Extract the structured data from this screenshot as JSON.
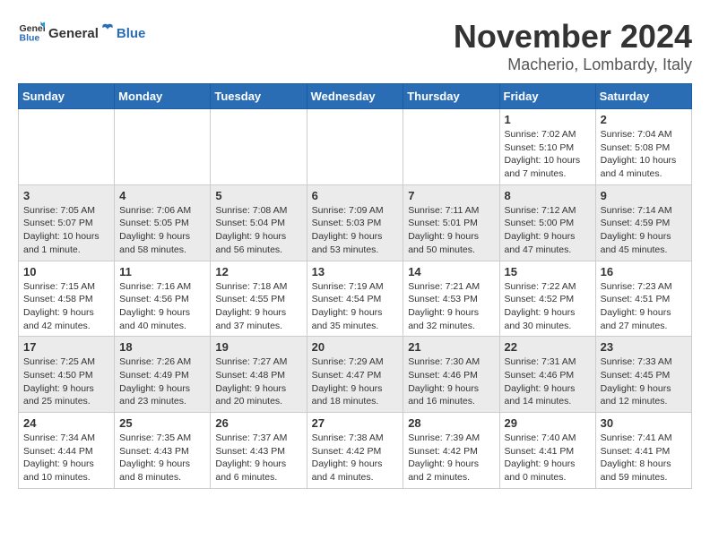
{
  "header": {
    "logo_general": "General",
    "logo_blue": "Blue",
    "month_title": "November 2024",
    "location": "Macherio, Lombardy, Italy"
  },
  "weekdays": [
    "Sunday",
    "Monday",
    "Tuesday",
    "Wednesday",
    "Thursday",
    "Friday",
    "Saturday"
  ],
  "weeks": [
    [
      {
        "day": "",
        "info": ""
      },
      {
        "day": "",
        "info": ""
      },
      {
        "day": "",
        "info": ""
      },
      {
        "day": "",
        "info": ""
      },
      {
        "day": "",
        "info": ""
      },
      {
        "day": "1",
        "info": "Sunrise: 7:02 AM\nSunset: 5:10 PM\nDaylight: 10 hours and 7 minutes."
      },
      {
        "day": "2",
        "info": "Sunrise: 7:04 AM\nSunset: 5:08 PM\nDaylight: 10 hours and 4 minutes."
      }
    ],
    [
      {
        "day": "3",
        "info": "Sunrise: 7:05 AM\nSunset: 5:07 PM\nDaylight: 10 hours and 1 minute."
      },
      {
        "day": "4",
        "info": "Sunrise: 7:06 AM\nSunset: 5:05 PM\nDaylight: 9 hours and 58 minutes."
      },
      {
        "day": "5",
        "info": "Sunrise: 7:08 AM\nSunset: 5:04 PM\nDaylight: 9 hours and 56 minutes."
      },
      {
        "day": "6",
        "info": "Sunrise: 7:09 AM\nSunset: 5:03 PM\nDaylight: 9 hours and 53 minutes."
      },
      {
        "day": "7",
        "info": "Sunrise: 7:11 AM\nSunset: 5:01 PM\nDaylight: 9 hours and 50 minutes."
      },
      {
        "day": "8",
        "info": "Sunrise: 7:12 AM\nSunset: 5:00 PM\nDaylight: 9 hours and 47 minutes."
      },
      {
        "day": "9",
        "info": "Sunrise: 7:14 AM\nSunset: 4:59 PM\nDaylight: 9 hours and 45 minutes."
      }
    ],
    [
      {
        "day": "10",
        "info": "Sunrise: 7:15 AM\nSunset: 4:58 PM\nDaylight: 9 hours and 42 minutes."
      },
      {
        "day": "11",
        "info": "Sunrise: 7:16 AM\nSunset: 4:56 PM\nDaylight: 9 hours and 40 minutes."
      },
      {
        "day": "12",
        "info": "Sunrise: 7:18 AM\nSunset: 4:55 PM\nDaylight: 9 hours and 37 minutes."
      },
      {
        "day": "13",
        "info": "Sunrise: 7:19 AM\nSunset: 4:54 PM\nDaylight: 9 hours and 35 minutes."
      },
      {
        "day": "14",
        "info": "Sunrise: 7:21 AM\nSunset: 4:53 PM\nDaylight: 9 hours and 32 minutes."
      },
      {
        "day": "15",
        "info": "Sunrise: 7:22 AM\nSunset: 4:52 PM\nDaylight: 9 hours and 30 minutes."
      },
      {
        "day": "16",
        "info": "Sunrise: 7:23 AM\nSunset: 4:51 PM\nDaylight: 9 hours and 27 minutes."
      }
    ],
    [
      {
        "day": "17",
        "info": "Sunrise: 7:25 AM\nSunset: 4:50 PM\nDaylight: 9 hours and 25 minutes."
      },
      {
        "day": "18",
        "info": "Sunrise: 7:26 AM\nSunset: 4:49 PM\nDaylight: 9 hours and 23 minutes."
      },
      {
        "day": "19",
        "info": "Sunrise: 7:27 AM\nSunset: 4:48 PM\nDaylight: 9 hours and 20 minutes."
      },
      {
        "day": "20",
        "info": "Sunrise: 7:29 AM\nSunset: 4:47 PM\nDaylight: 9 hours and 18 minutes."
      },
      {
        "day": "21",
        "info": "Sunrise: 7:30 AM\nSunset: 4:46 PM\nDaylight: 9 hours and 16 minutes."
      },
      {
        "day": "22",
        "info": "Sunrise: 7:31 AM\nSunset: 4:46 PM\nDaylight: 9 hours and 14 minutes."
      },
      {
        "day": "23",
        "info": "Sunrise: 7:33 AM\nSunset: 4:45 PM\nDaylight: 9 hours and 12 minutes."
      }
    ],
    [
      {
        "day": "24",
        "info": "Sunrise: 7:34 AM\nSunset: 4:44 PM\nDaylight: 9 hours and 10 minutes."
      },
      {
        "day": "25",
        "info": "Sunrise: 7:35 AM\nSunset: 4:43 PM\nDaylight: 9 hours and 8 minutes."
      },
      {
        "day": "26",
        "info": "Sunrise: 7:37 AM\nSunset: 4:43 PM\nDaylight: 9 hours and 6 minutes."
      },
      {
        "day": "27",
        "info": "Sunrise: 7:38 AM\nSunset: 4:42 PM\nDaylight: 9 hours and 4 minutes."
      },
      {
        "day": "28",
        "info": "Sunrise: 7:39 AM\nSunset: 4:42 PM\nDaylight: 9 hours and 2 minutes."
      },
      {
        "day": "29",
        "info": "Sunrise: 7:40 AM\nSunset: 4:41 PM\nDaylight: 9 hours and 0 minutes."
      },
      {
        "day": "30",
        "info": "Sunrise: 7:41 AM\nSunset: 4:41 PM\nDaylight: 8 hours and 59 minutes."
      }
    ]
  ]
}
